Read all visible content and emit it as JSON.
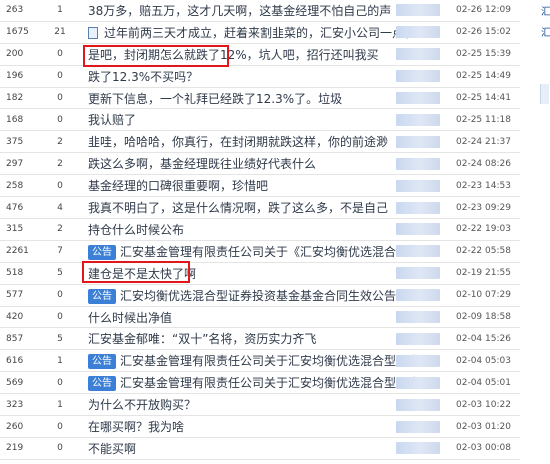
{
  "rows": [
    {
      "views": "263",
      "replies": "1",
      "title": "38万多，赔五万，这才几天啊，这基金经理不怕自己的声",
      "badge": "",
      "date": "02-26 12:09"
    },
    {
      "views": "1675",
      "replies": "21",
      "title": "过年前两三天才成立，赶着来割韭菜的，汇安小公司一点影",
      "badge": "",
      "date": "02-26 15:02",
      "doc_icon": true
    },
    {
      "views": "200",
      "replies": "0",
      "title": "是吧，封闭期怎么就跌了12%，坑人吧，招行还叫我买",
      "badge": "",
      "date": "02-25 15:39"
    },
    {
      "views": "196",
      "replies": "0",
      "title": "跌了12.3%不买吗？",
      "badge": "",
      "date": "02-25 14:49"
    },
    {
      "views": "182",
      "replies": "0",
      "title": "更新下信息，一个礼拜已经跌了12.3%了。垃圾",
      "badge": "",
      "date": "02-25 14:41"
    },
    {
      "views": "168",
      "replies": "0",
      "title": "我认赔了",
      "badge": "",
      "date": "02-25 11:18"
    },
    {
      "views": "375",
      "replies": "2",
      "title": "韭哇，哈哈哈，你真行，在封闭期就跌这样，你的前途渺",
      "badge": "",
      "date": "02-24 21:37"
    },
    {
      "views": "297",
      "replies": "2",
      "title": "跌这么多啊，基金经理既往业绩好代表什么",
      "badge": "",
      "date": "02-24 08:26"
    },
    {
      "views": "258",
      "replies": "0",
      "title": "基金经理的口碑很重要啊，珍惜吧",
      "badge": "",
      "date": "02-23 14:53"
    },
    {
      "views": "476",
      "replies": "4",
      "title": "我真不明白了，这是什么情况啊，跌了这么多，不是自己",
      "badge": "",
      "date": "02-23 09:29"
    },
    {
      "views": "315",
      "replies": "2",
      "title": "持仓什么时候公布",
      "badge": "",
      "date": "02-22 19:03"
    },
    {
      "views": "2261",
      "replies": "7",
      "title": "汇安基金管理有限责任公司关于《汇安均衡优选混合型证",
      "badge": "公告",
      "date": "02-22 05:58"
    },
    {
      "views": "518",
      "replies": "5",
      "title": "建仓是不是太快了啊",
      "badge": "",
      "date": "02-19 21:55"
    },
    {
      "views": "577",
      "replies": "0",
      "title": "汇安均衡优选混合型证券投资基金基金合同生效公告",
      "badge": "公告",
      "date": "02-10 07:29"
    },
    {
      "views": "420",
      "replies": "0",
      "title": "什么时候出净值",
      "badge": "",
      "date": "02-09 18:58"
    },
    {
      "views": "857",
      "replies": "5",
      "title": "汇安基金郁唯：“双十”名将，资历实力齐飞",
      "badge": "",
      "date": "02-04 15:26"
    },
    {
      "views": "616",
      "replies": "1",
      "title": "汇安基金管理有限责任公司关于汇安均衡优选混合型证券",
      "badge": "公告",
      "date": "02-04 05:03"
    },
    {
      "views": "569",
      "replies": "0",
      "title": "汇安基金管理有限责任公司关于汇安均衡优选混合型证券",
      "badge": "公告",
      "date": "02-04 05:01"
    },
    {
      "views": "323",
      "replies": "1",
      "title": "为什么不开放购买？",
      "badge": "",
      "date": "02-03 10:22"
    },
    {
      "views": "260",
      "replies": "0",
      "title": "在哪买啊？我为啥",
      "badge": "",
      "date": "02-03 01:20"
    },
    {
      "views": "219",
      "replies": "0",
      "title": "不能买啊",
      "badge": "",
      "date": "02-03 00:08"
    }
  ],
  "highlight_color": "#e0181b",
  "badge_color": "#3b7fd6",
  "sidebar_chars": [
    "汇",
    "汇"
  ]
}
